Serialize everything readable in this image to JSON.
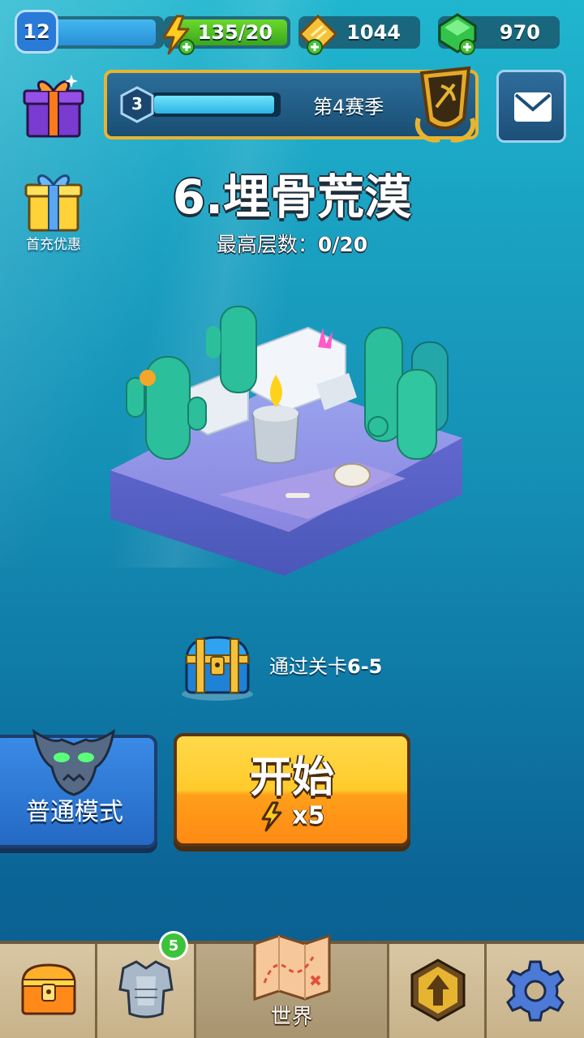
{
  "topbar": {
    "player_level": "12",
    "energy": "135/20",
    "coins": "1044",
    "gems": "970"
  },
  "season": {
    "level": "3",
    "label": "第4赛季"
  },
  "first_charge": {
    "label": "首充优惠"
  },
  "stage": {
    "title": "6.埋骨荒漠",
    "max_floor_label": "最高层数：",
    "max_floor_value": "0/20"
  },
  "reward": {
    "text_prefix": "通过关卡",
    "text_stage": "6-5"
  },
  "mode_button": {
    "label": "普通模式"
  },
  "start_button": {
    "label": "开始",
    "cost": "x5"
  },
  "bottom_nav": {
    "items": [
      {
        "name": "chest",
        "label": ""
      },
      {
        "name": "equipment",
        "label": "",
        "badge": "5"
      },
      {
        "name": "world",
        "label": "世界"
      },
      {
        "name": "upgrade",
        "label": ""
      },
      {
        "name": "settings",
        "label": ""
      }
    ]
  },
  "colors": {
    "accent_gold": "#e7b431",
    "energy_green": "#3aa51c",
    "start_orange": "#ff9f1a",
    "mode_blue": "#2469c4"
  }
}
